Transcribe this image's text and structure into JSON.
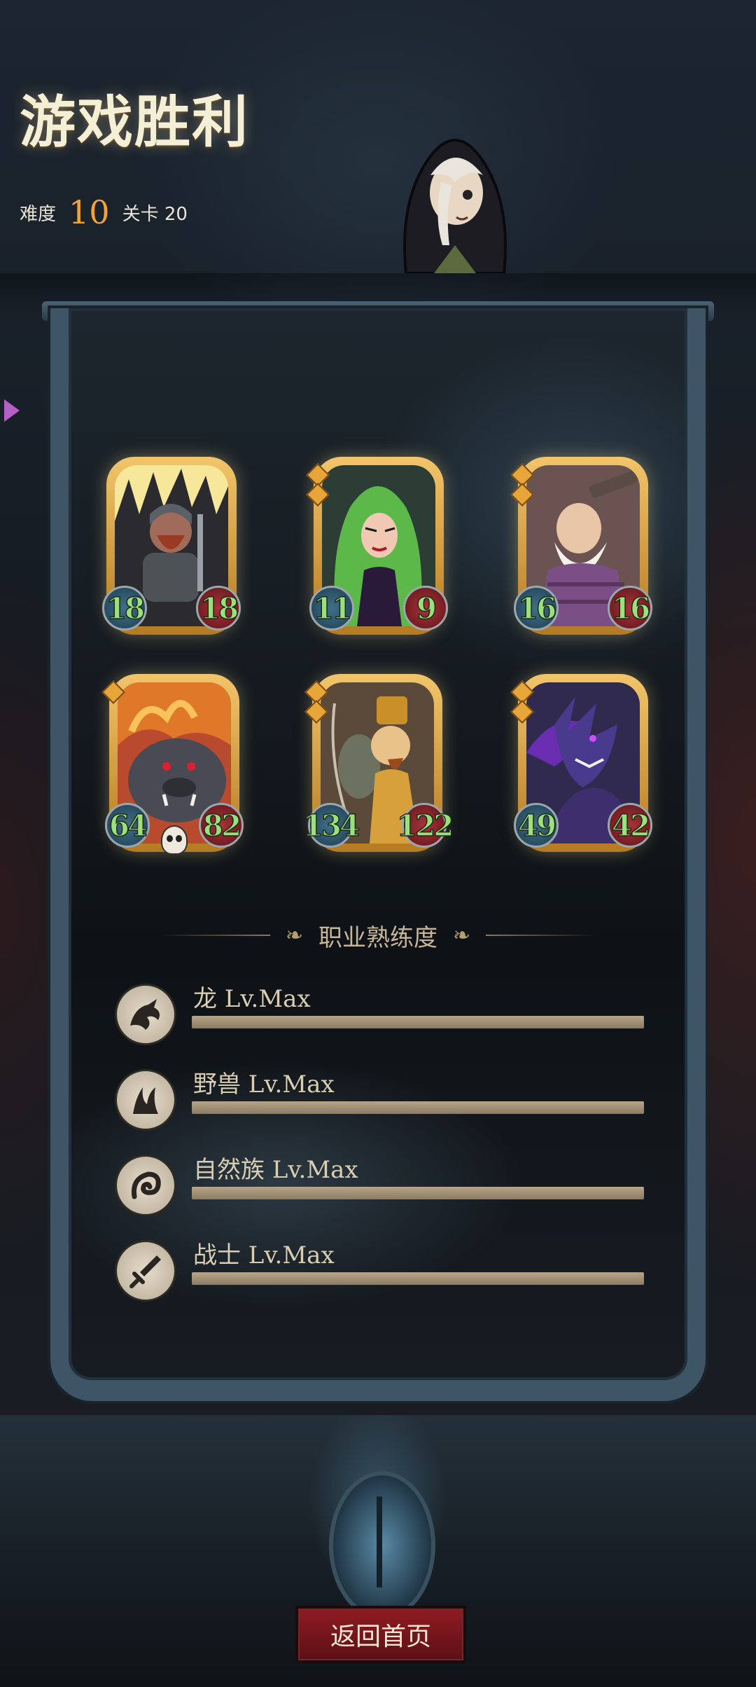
{
  "header": {
    "title": "游戏胜利",
    "difficulty_label": "难度",
    "difficulty_value": "10",
    "stage_label": "关卡 20"
  },
  "cards": [
    {
      "name": "ogre-warrior-card",
      "attack": "18",
      "health": "18",
      "art": "orc"
    },
    {
      "name": "medusa-card",
      "attack": "11",
      "health": "9",
      "art": "medusa"
    },
    {
      "name": "old-bruiser-card",
      "attack": "16",
      "health": "16",
      "art": "old-man"
    },
    {
      "name": "fire-boar-card",
      "attack": "64",
      "health": "82",
      "art": "boar",
      "skull": true
    },
    {
      "name": "archer-duo-card",
      "attack": "134",
      "health": "122",
      "art": "archer"
    },
    {
      "name": "shadow-dragon-card",
      "attack": "49",
      "health": "42",
      "art": "dragon"
    }
  ],
  "mastery": {
    "title": "职业熟练度",
    "items": [
      {
        "label": "龙 Lv.Max",
        "icon": "dragon-icon",
        "progress": 1.0
      },
      {
        "label": "野兽 Lv.Max",
        "icon": "beast-claw-icon",
        "progress": 1.0
      },
      {
        "label": "自然族 Lv.Max",
        "icon": "nature-swirl-icon",
        "progress": 1.0
      },
      {
        "label": "战士 Lv.Max",
        "icon": "sword-icon",
        "progress": 1.0
      }
    ]
  },
  "footer": {
    "home_button": "返回首页"
  },
  "colors": {
    "gold": "#f2a536",
    "frame": "#3e5566",
    "attack_stat": "#3f6f88",
    "health_stat": "#a8333a",
    "stat_text": "#9be07c",
    "button": "#8e1c22"
  }
}
